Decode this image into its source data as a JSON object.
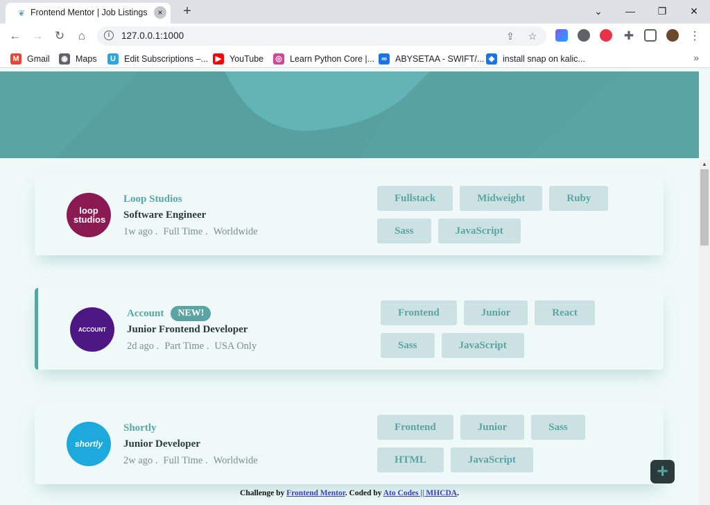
{
  "browser": {
    "tab_title": "Frontend Mentor | Job Listings",
    "tab_close": "×",
    "new_tab": "+",
    "url": "127.0.0.1:1000",
    "window": {
      "minimize": "—",
      "restore": "❐",
      "close": "✕",
      "list": "⌄"
    },
    "bookmarks": [
      {
        "label": "Gmail",
        "icon": "gmail-icon",
        "color": "#ea4335",
        "glyph": "M"
      },
      {
        "label": "Maps",
        "icon": "maps-icon",
        "color": "#5f6368",
        "glyph": "◉"
      },
      {
        "label": "Edit Subscriptions –...",
        "icon": "udemy-icon",
        "color": "#2ba6e0",
        "glyph": "U"
      },
      {
        "label": "YouTube",
        "icon": "youtube-icon",
        "color": "#ff0000",
        "glyph": "▶"
      },
      {
        "label": "Learn Python Core |...",
        "icon": "sololearn-icon",
        "color": "#d3459a",
        "glyph": "◎"
      },
      {
        "label": "ABYSETAA - SWIFT/...",
        "icon": "infinity-icon",
        "color": "#1a73e8",
        "glyph": "∞"
      },
      {
        "label": "install snap on kalic...",
        "icon": "drop-icon",
        "color": "#1a73e8",
        "glyph": "◆"
      }
    ],
    "bookmarks_more": "»"
  },
  "jobs": [
    {
      "company": "Loop Studios",
      "new": "",
      "position": "Software Engineer",
      "posted": "1w ago .",
      "contract": "Full Time .",
      "location": "Worldwide",
      "logo_text": "loop studios",
      "logo_color": "#8c1a52",
      "featured": false,
      "tags": [
        "Fullstack",
        "Midweight",
        "Ruby",
        "Sass",
        "JavaScript"
      ]
    },
    {
      "company": "Account",
      "new": "NEW!",
      "position": "Junior Frontend Developer",
      "posted": "2d ago .",
      "contract": "Part Time .",
      "location": "USA Only",
      "logo_text": "ACCOUNT",
      "logo_color": "#4d1784",
      "featured": true,
      "tags": [
        "Frontend",
        "Junior",
        "React",
        "Sass",
        "JavaScript"
      ]
    },
    {
      "company": "Shortly",
      "new": "",
      "position": "Junior Developer",
      "posted": "2w ago .",
      "contract": "Full Time .",
      "location": "Worldwide",
      "logo_text": "shortly",
      "logo_color": "#1ea9dc",
      "featured": false,
      "tags": [
        "Frontend",
        "Junior",
        "Sass",
        "HTML",
        "JavaScript"
      ]
    }
  ],
  "footer": {
    "prefix": "Challenge by ",
    "link1": "Frontend Mentor",
    "middle": ". Coded by ",
    "link2": "Ato Codes || MHCDA",
    "suffix": "."
  },
  "fab_label": "+",
  "colors": {
    "primary": "#5ba4a4",
    "background": "#eff9f8",
    "tag_bg": "#cce2e2",
    "dark": "#2c3a3a"
  }
}
